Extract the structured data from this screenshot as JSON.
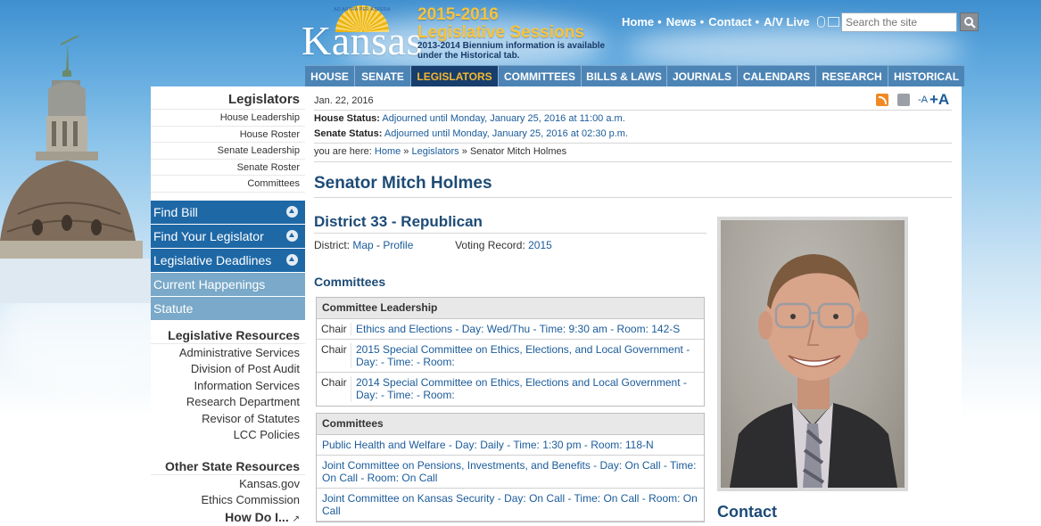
{
  "header": {
    "logo_text": "Kansas",
    "logo_arc_text": "AD ASTRA PER ASPERA",
    "session_years": "2015-2016",
    "session_title": "Legislative Sessions",
    "biennium_note": "2013-2014 Biennium information is available under the Historical tab.",
    "top_links": [
      "Home",
      "News",
      "Contact",
      "A/V Live"
    ],
    "search_placeholder": "Search the site"
  },
  "nav": {
    "items": [
      "HOUSE",
      "SENATE",
      "LEGISLATORS",
      "COMMITTEES",
      "BILLS & LAWS",
      "JOURNALS",
      "CALENDARS",
      "RESEARCH",
      "HISTORICAL"
    ],
    "active": "LEGISLATORS"
  },
  "sidebar": {
    "section_title": "Legislators",
    "links": [
      "House Leadership",
      "House Roster",
      "Senate Leadership",
      "Senate Roster",
      "Committees"
    ],
    "blue_buttons": [
      "Find Bill",
      "Find Your Legislator",
      "Legislative Deadlines"
    ],
    "light_buttons": [
      "Current Happenings",
      "Statute"
    ],
    "resources_title": "Legislative Resources",
    "resources": [
      "Administrative Services",
      "Division of Post Audit",
      "Information Services",
      "Research Department",
      "Revisor of Statutes",
      "LCC Policies"
    ],
    "other_title": "Other State Resources",
    "other": [
      "Kansas.gov",
      "Ethics Commission"
    ],
    "how_do_i": "How Do I..."
  },
  "main": {
    "date": "Jan. 22, 2016",
    "font_small": "-A",
    "font_large": "+A",
    "house_status_label": "House Status:",
    "house_status": "Adjourned until Monday, January 25, 2016 at 11:00 a.m.",
    "senate_status_label": "Senate Status:",
    "senate_status": "Adjourned until Monday, January 25, 2016 at 02:30 p.m.",
    "breadcrumb_prefix": "you are here:",
    "breadcrumb_home": "Home",
    "breadcrumb_sep": "»",
    "breadcrumb_legislators": "Legislators",
    "breadcrumb_current": "Senator Mitch Holmes",
    "title": "Senator Mitch Holmes",
    "district": "District 33 - Republican",
    "district_label": "District:",
    "map_link": "Map",
    "profile_link": "Profile",
    "voting_label": "Voting Record:",
    "voting_link": "2015",
    "committees_heading": "Committees",
    "leadership_header": "Committee Leadership",
    "leadership_rows": [
      {
        "role": "Chair",
        "name": "Ethics and Elections - Day: Wed/Thu - Time: 9:30 am - Room: 142-S"
      },
      {
        "role": "Chair",
        "name": "2015 Special Committee on Ethics, Elections, and Local Government - Day: - Time: - Room:"
      },
      {
        "role": "Chair",
        "name": "2014 Special Committee on Ethics, Elections and Local Government - Day: - Time: - Room:"
      }
    ],
    "committees_header": "Committees",
    "committee_rows": [
      "Public Health and Welfare - Day: Daily - Time: 1:30 pm - Room: 118-N",
      "Joint Committee on Pensions, Investments, and Benefits - Day: On Call - Time: On Call - Room: On Call",
      "Joint Committee on Kansas Security - Day: On Call - Time: On Call - Room: On Call"
    ],
    "contact_heading": "Contact"
  }
}
